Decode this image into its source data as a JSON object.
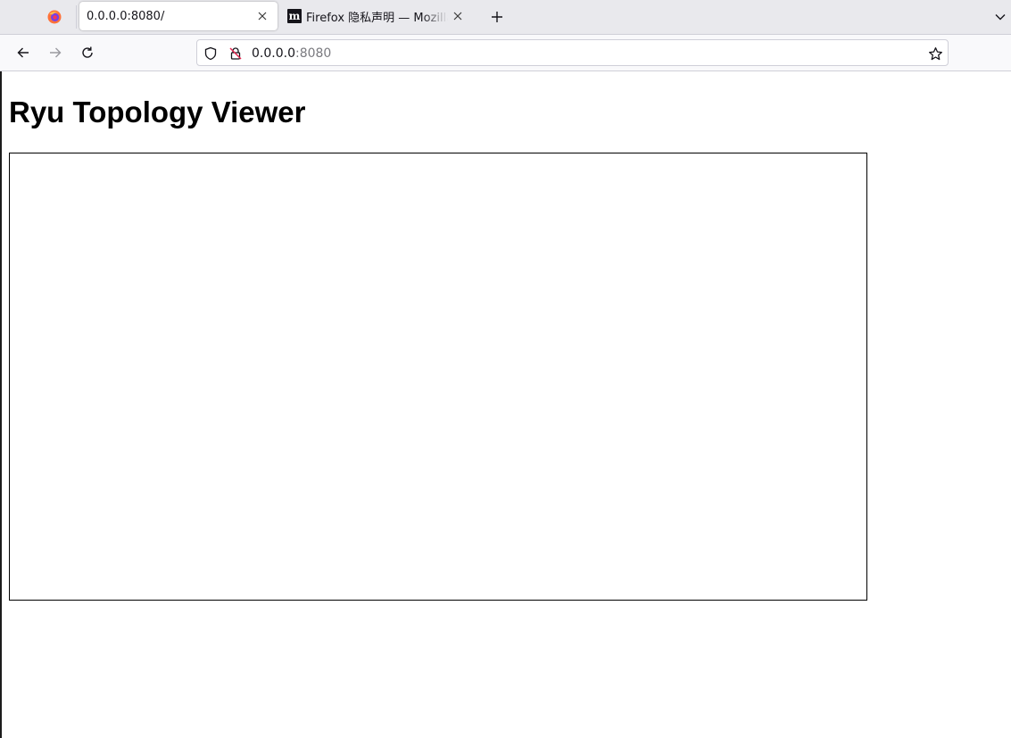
{
  "browser": {
    "tabs": [
      {
        "title": "0.0.0.0:8080/",
        "active": true
      },
      {
        "title": "Firefox 隐私声明 — Mozilla",
        "favicon": "m",
        "active": false
      }
    ],
    "urlbar": {
      "host": "0.0.0.0",
      "port": ":8080"
    },
    "icons": {
      "firefox_view": "firefox-logo-icon",
      "close": "close-icon",
      "new_tab": "plus-icon",
      "list_tabs": "chevron-down-icon",
      "back": "back-arrow-icon",
      "forward": "forward-arrow-icon",
      "reload": "reload-icon",
      "tracking_protection": "shield-icon",
      "connection": "insecure-lock-icon",
      "bookmark": "star-icon"
    },
    "colors": {
      "tabstrip": "#e9e9ed",
      "navbar": "#f9f9fb",
      "text": "#15141a"
    }
  },
  "page": {
    "title": "Ryu Topology Viewer"
  }
}
